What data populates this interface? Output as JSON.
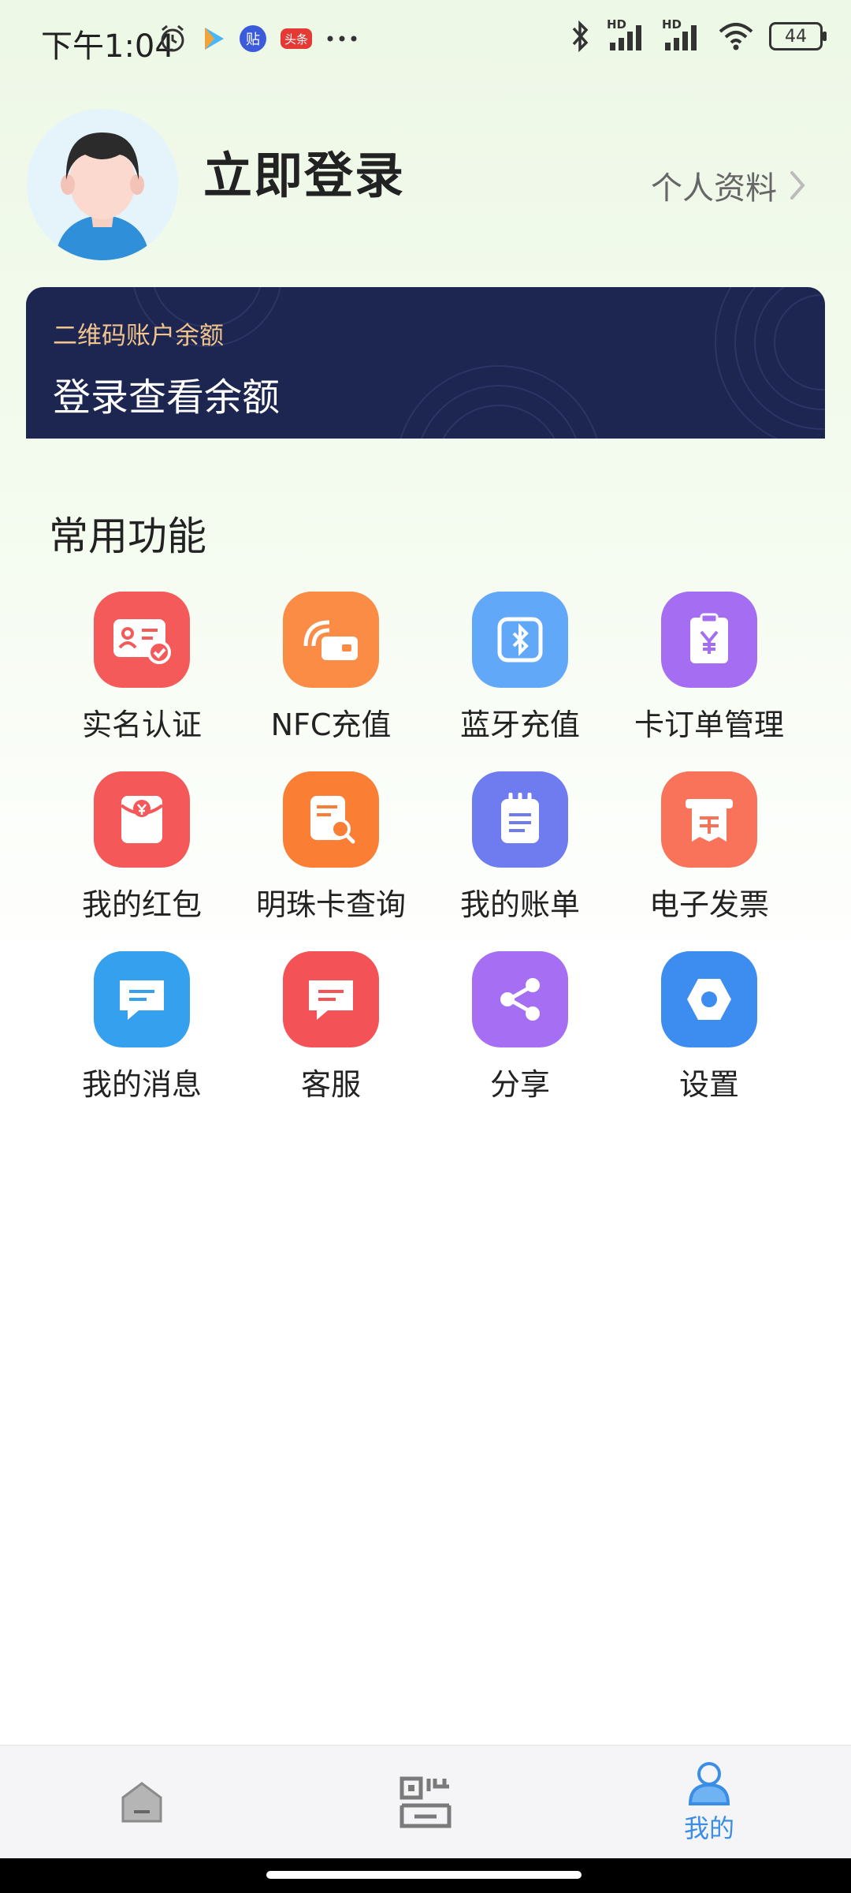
{
  "status_bar": {
    "time": "下午1:04",
    "battery": "44",
    "icons": [
      "alarm-icon",
      "play-icon",
      "tieba-icon",
      "toutiao-icon",
      "more-icon",
      "bluetooth-icon",
      "signal-icon",
      "signal-icon",
      "wifi-icon",
      "battery-icon"
    ],
    "toutiao_text": "头条",
    "tieba_text": "贴",
    "hd_label": "HD"
  },
  "profile": {
    "login_title": "立即登录",
    "profile_link": "个人资料"
  },
  "balance_card": {
    "label": "二维码账户余额",
    "value": "登录查看余额"
  },
  "functions": {
    "title": "常用功能",
    "items": [
      {
        "label": "实名认证",
        "icon": "id-card-icon",
        "color": "#f45a5a"
      },
      {
        "label": "NFC充值",
        "icon": "nfc-card-icon",
        "color": "#fa8c45"
      },
      {
        "label": "蓝牙充值",
        "icon": "bluetooth-icon",
        "color": "#62a8f8"
      },
      {
        "label": "卡订单管理",
        "icon": "yuan-order-icon",
        "color": "#a56ef2"
      },
      {
        "label": "我的红包",
        "icon": "red-envelope-icon",
        "color": "#f55859"
      },
      {
        "label": "明珠卡查询",
        "icon": "doc-search-icon",
        "color": "#fb7e35"
      },
      {
        "label": "我的账单",
        "icon": "bill-clipboard-icon",
        "color": "#6f7cf0"
      },
      {
        "label": "电子发票",
        "icon": "invoice-icon",
        "color": "#f8735a"
      },
      {
        "label": "我的消息",
        "icon": "message-icon",
        "color": "#34a0ee"
      },
      {
        "label": "客服",
        "icon": "customer-service-icon",
        "color": "#f35256"
      },
      {
        "label": "分享",
        "icon": "share-icon",
        "color": "#a66ef2"
      },
      {
        "label": "设置",
        "icon": "settings-hexagon-icon",
        "color": "#3d8cf0"
      }
    ]
  },
  "bottom_nav": {
    "items": [
      {
        "label": "",
        "icon": "home-icon",
        "active": false
      },
      {
        "label": "",
        "icon": "qr-code-icon",
        "active": false
      },
      {
        "label": "我的",
        "icon": "user-icon",
        "active": true
      }
    ]
  },
  "colors": {
    "accent": "#3a8ee6",
    "card_bg": "#1d2650",
    "card_label": "#f2c48d"
  }
}
